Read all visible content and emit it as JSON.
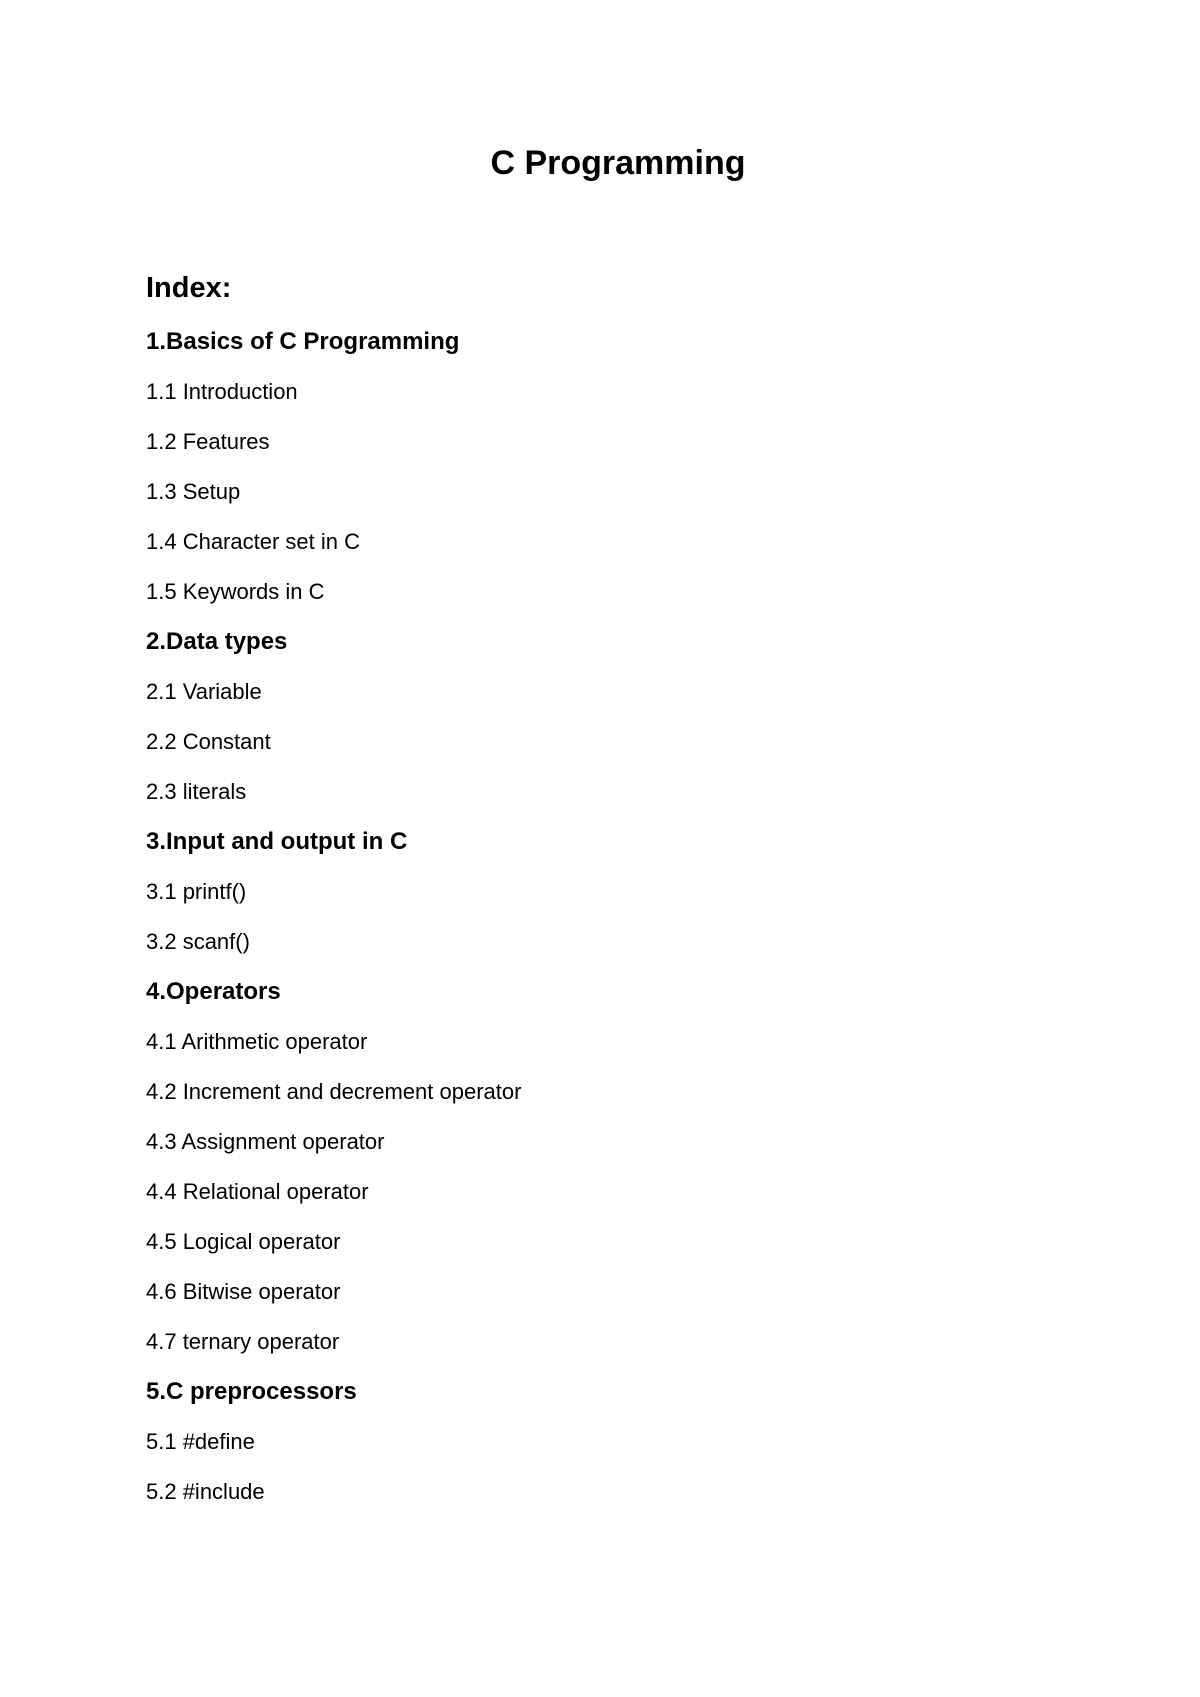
{
  "document": {
    "title": "C Programming",
    "index_heading": "Index:",
    "sections": [
      {
        "heading": "1.Basics of C Programming",
        "items": [
          "1.1 Introduction",
          "1.2 Features",
          "1.3 Setup",
          "1.4 Character set in C",
          "1.5 Keywords in C"
        ]
      },
      {
        "heading": "2.Data types",
        "items": [
          "2.1 Variable",
          "2.2 Constant",
          "2.3 literals"
        ]
      },
      {
        "heading": "3.Input and output in C",
        "items": [
          "3.1 printf()",
          "3.2 scanf()"
        ]
      },
      {
        "heading": "4.Operators",
        "items": [
          "4.1 Arithmetic operator",
          "4.2 Increment and decrement operator",
          "4.3 Assignment operator",
          "4.4 Relational operator",
          "4.5 Logical operator",
          "4.6 Bitwise operator",
          "4.7 ternary operator"
        ]
      },
      {
        "heading": "5.C preprocessors",
        "items": [
          "5.1 #define",
          "5.2 #include"
        ]
      }
    ]
  }
}
